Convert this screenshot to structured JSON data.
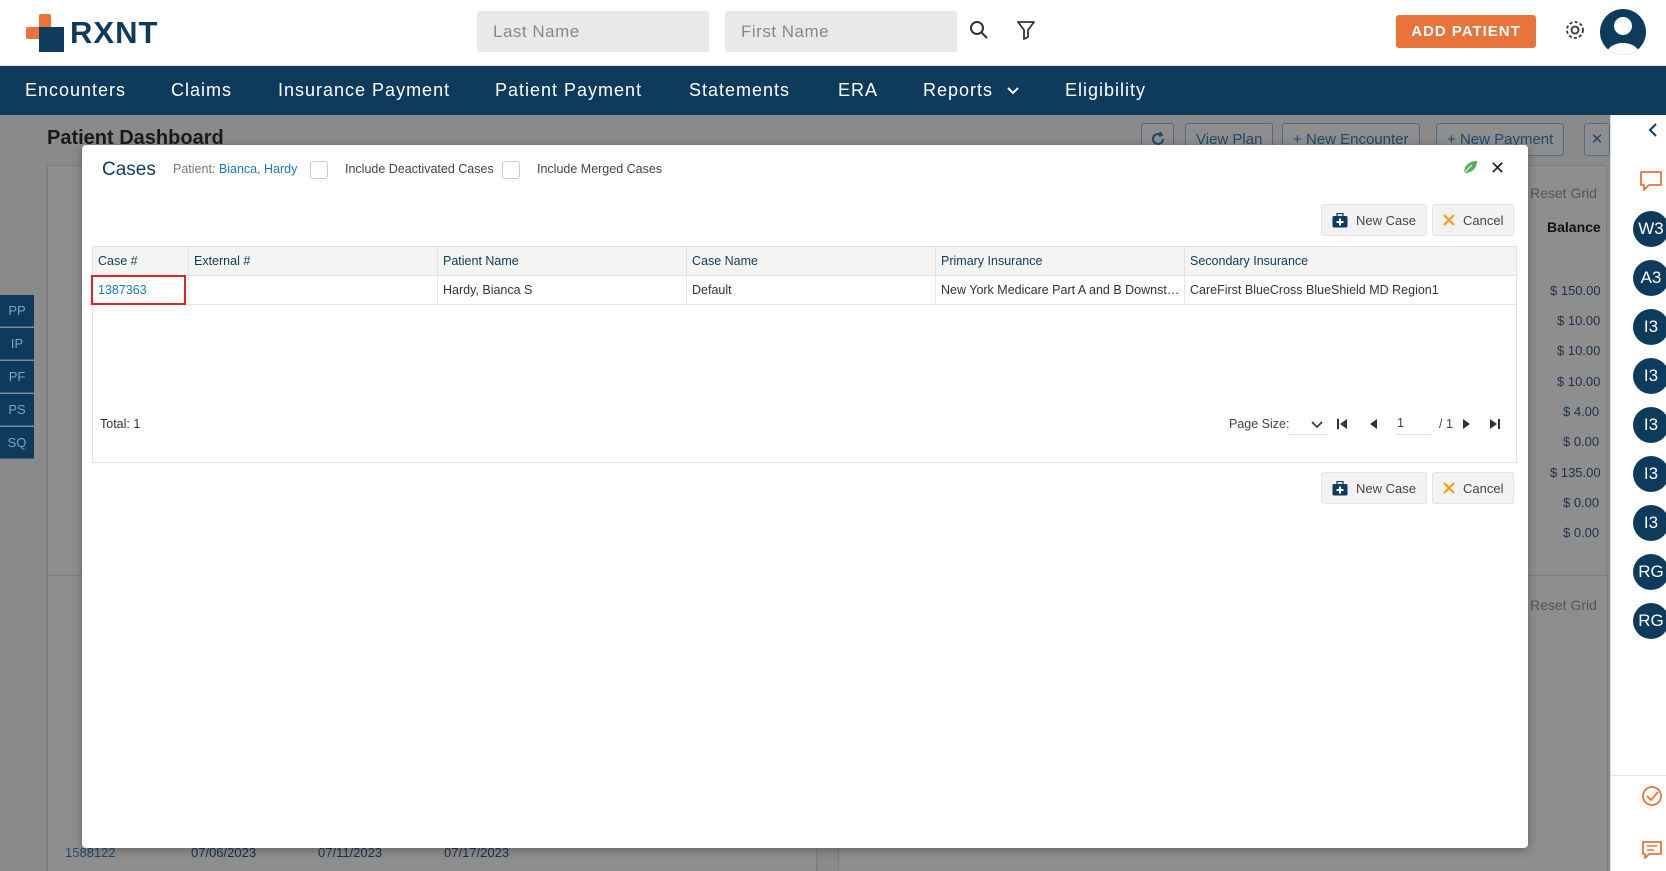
{
  "header": {
    "logo_text": "RXNT",
    "last_name_placeholder": "Last Name",
    "first_name_placeholder": "First Name",
    "add_patient_label": "ADD PATIENT"
  },
  "nav": {
    "items": [
      {
        "label": "Encounters"
      },
      {
        "label": "Claims"
      },
      {
        "label": "Insurance Payment"
      },
      {
        "label": "Patient Payment"
      },
      {
        "label": "Statements"
      },
      {
        "label": "ERA"
      },
      {
        "label": "Reports"
      },
      {
        "label": "Eligibility"
      }
    ]
  },
  "background": {
    "title": "Patient Dashboard",
    "buttons": [
      "View Plan",
      "New Encounter",
      "New Payment"
    ],
    "reset_grid": "Reset Grid",
    "balance_header": "Balance",
    "balances": [
      "$ 150.00",
      "$ 10.00",
      "$ 10.00",
      "$ 10.00",
      "$ 4.00",
      "$ 0.00",
      "$ 135.00",
      "$ 0.00",
      "$ 0.00"
    ],
    "side_tabs": [
      "PP",
      "IP",
      "PF",
      "PS",
      "SQ"
    ],
    "lower_row": [
      "1588122",
      "07/06/2023",
      "07/11/2023",
      "07/17/2023"
    ]
  },
  "rail": {
    "bubbles": [
      "W3",
      "A3",
      "I3",
      "I3",
      "I3",
      "I3",
      "I3",
      "RG",
      "RG"
    ]
  },
  "modal": {
    "title": "Cases",
    "patient_label": "Patient:",
    "patient_name": "Bianca, Hardy",
    "include_deactivated_label": "Include Deactivated Cases",
    "include_merged_label": "Include Merged Cases",
    "new_case_label": "New Case",
    "cancel_label": "Cancel",
    "columns": [
      "Case #",
      "External #",
      "Patient Name",
      "Case Name",
      "Primary Insurance",
      "Secondary Insurance"
    ],
    "rows": [
      {
        "case_no": "1387363",
        "external_no": "",
        "patient_name": "Hardy, Bianca S",
        "case_name": "Default",
        "primary_insurance": "New York Medicare Part A and B Downstat...",
        "secondary_insurance": "CareFirst BlueCross BlueShield MD Region1"
      }
    ],
    "total_label": "Total: 1",
    "page_size_label": "Page Size:",
    "page_number": "1",
    "page_total": "/ 1"
  },
  "colors": {
    "brand_navy": "#0e3b5c",
    "brand_orange": "#e8743b",
    "link_blue": "#1a7bbf",
    "highlight_red": "#e32020"
  }
}
